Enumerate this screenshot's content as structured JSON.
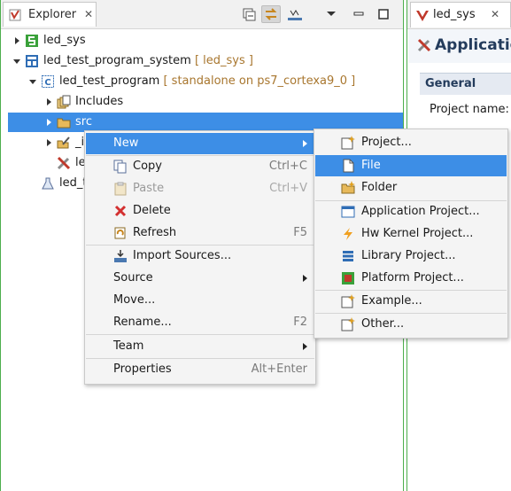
{
  "explorer": {
    "tab_title": "Explorer",
    "tab_close": "✕",
    "tree": [
      {
        "label": "led_sys",
        "decoration": "",
        "icon": "hardware-platform-icon"
      },
      {
        "label": "led_test_program_system",
        "decoration": "[ led_sys ]",
        "icon": "system-project-icon"
      },
      {
        "label": "led_test_program",
        "decoration": "[ standalone on ps7_cortexa9_0 ]",
        "icon": "application-project-icon"
      },
      {
        "label": "Includes",
        "decoration": "",
        "icon": "includes-icon"
      },
      {
        "label": "src",
        "decoration": "",
        "icon": "folder-icon"
      },
      {
        "label": "_i",
        "decoration": "",
        "icon": "folder-edit-icon"
      },
      {
        "label": "le",
        "decoration": "",
        "icon": "tools-icon"
      },
      {
        "label": "led_t",
        "decoration": "",
        "icon": "flask-icon"
      }
    ]
  },
  "context_menu": {
    "items": [
      {
        "label": "New",
        "accel": ""
      },
      {
        "label": "Copy",
        "accel": "Ctrl+C"
      },
      {
        "label": "Paste",
        "accel": "Ctrl+V"
      },
      {
        "label": "Delete",
        "accel": ""
      },
      {
        "label": "Refresh",
        "accel": "F5"
      },
      {
        "label": "Import Sources...",
        "accel": ""
      },
      {
        "label": "Source",
        "accel": ""
      },
      {
        "label": "Move...",
        "accel": ""
      },
      {
        "label": "Rename...",
        "accel": "F2"
      },
      {
        "label": "Team",
        "accel": ""
      },
      {
        "label": "Properties",
        "accel": "Alt+Enter"
      }
    ]
  },
  "new_submenu": {
    "items": [
      {
        "label": "Project..."
      },
      {
        "label": "File"
      },
      {
        "label": "Folder"
      },
      {
        "label": "Application Project..."
      },
      {
        "label": "Hw Kernel Project..."
      },
      {
        "label": "Library Project..."
      },
      {
        "label": "Platform Project..."
      },
      {
        "label": "Example..."
      },
      {
        "label": "Other..."
      }
    ]
  },
  "editor": {
    "tab_title": "led_sys",
    "tab_close": "✕",
    "header_title": "Application",
    "section_title": "General",
    "field_label": "Project name:"
  },
  "colors": {
    "selection": "#3d8ee6",
    "view_border": "#4cae4c",
    "decoration_text": "#a8762e"
  }
}
